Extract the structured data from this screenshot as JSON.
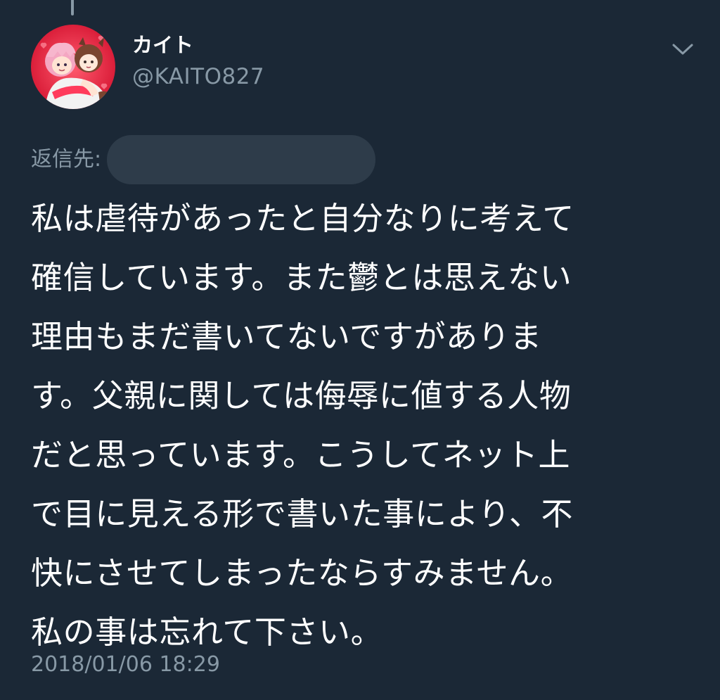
{
  "tweet": {
    "display_name": "カイト",
    "handle": "@KAITO827",
    "reply_label": "返信先:",
    "reply_target": "",
    "text_lines": [
      "私は虐待があったと自分なりに考えて",
      "確信しています。また鬱とは思えない",
      "理由もまだ書いてないですがありま",
      "す。父親に関しては侮辱に値する人物",
      "だと思っています。こうしてネット上",
      "で目に見える形で書いた事により、不",
      "快にさせてしまったならすみません。",
      "私の事は忘れて下さい。"
    ],
    "timestamp": "2018/01/06 18:29"
  },
  "icons": {
    "menu": "chevron-down-icon",
    "avatar": "avatar-illustration"
  },
  "colors": {
    "background": "#1b2836",
    "text_primary": "#ffffff",
    "text_secondary": "#8899a6",
    "redaction": "#2e3c4a",
    "avatar_red": "#e51e3a"
  }
}
